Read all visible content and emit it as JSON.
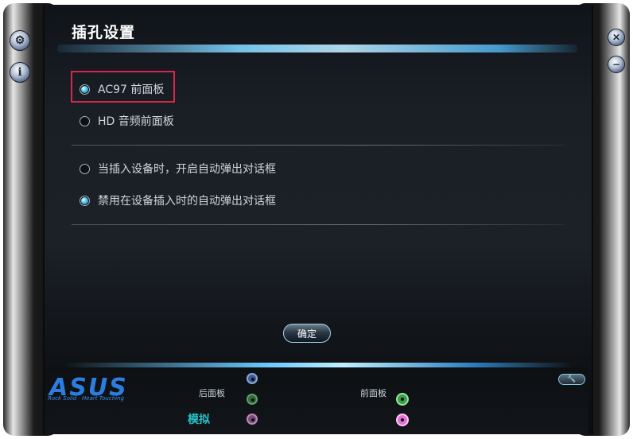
{
  "window": {
    "title": "插孔设置"
  },
  "panel_options": [
    {
      "label": "AC97 前面板",
      "selected": true
    },
    {
      "label": "HD 音频前面板",
      "selected": false
    }
  ],
  "dialog_options": [
    {
      "label": "当插入设备时，开启自动弹出对话框",
      "selected": false
    },
    {
      "label": "禁用在设备插入时的自动弹出对话框",
      "selected": true
    }
  ],
  "buttons": {
    "ok_label": "确定"
  },
  "side_icons": {
    "left": [
      "gear-icon",
      "info-icon"
    ],
    "right": [
      "close-icon",
      "minimize-icon"
    ]
  },
  "footer": {
    "logo_text": "ASUS",
    "slogan": "Rock Solid · Heart Touching",
    "rear_panel_label": "后面板",
    "front_panel_label": "前面板",
    "analog_label": "模拟"
  },
  "colors": {
    "accent": "#4cc6ee",
    "highlight_border": "#d6284a",
    "logo": "#2b7de0",
    "analog": "#28c0c8"
  }
}
